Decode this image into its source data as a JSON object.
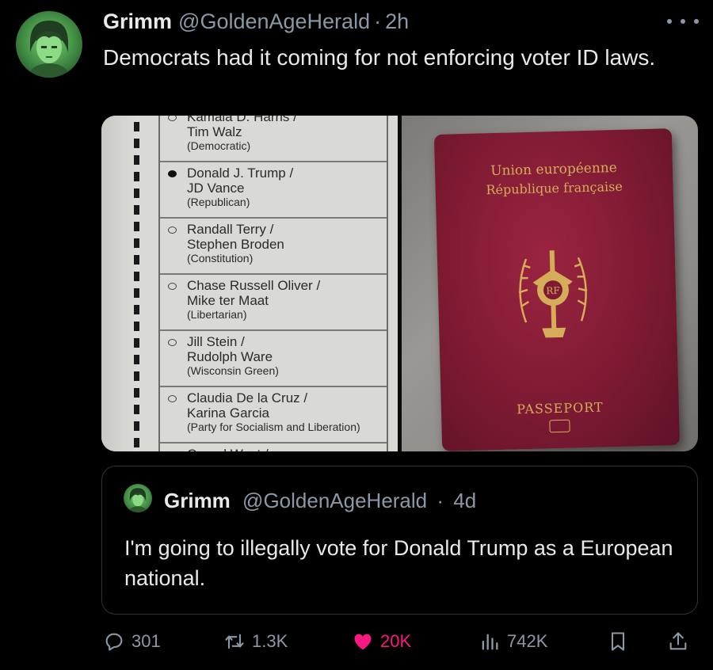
{
  "post": {
    "author_name": "Grimm",
    "author_handle": "@GoldenAgeHerald",
    "separator": "·",
    "time": "2h",
    "text": "Democrats had it coming for not enforcing voter ID laws."
  },
  "ballot": {
    "candidates": [
      {
        "line1": "Kamala D. Harris /",
        "line2": "Tim Walz",
        "party": "(Democratic)",
        "filled": false
      },
      {
        "line1": "Donald J. Trump /",
        "line2": "JD Vance",
        "party": "(Republican)",
        "filled": true
      },
      {
        "line1": "Randall Terry /",
        "line2": "Stephen Broden",
        "party": "(Constitution)",
        "filled": false
      },
      {
        "line1": "Chase Russell Oliver /",
        "line2": "Mike ter Maat",
        "party": "(Libertarian)",
        "filled": false
      },
      {
        "line1": "Jill Stein /",
        "line2": "Rudolph Ware",
        "party": "(Wisconsin Green)",
        "filled": false
      },
      {
        "line1": "Claudia De la Cruz /",
        "line2": "Karina Garcia",
        "party": "(Party for Socialism and Liberation)",
        "filled": false
      },
      {
        "line1": "Cornel West /",
        "line2": "",
        "party": "",
        "filled": false
      }
    ]
  },
  "passport": {
    "union": "Union européenne",
    "republic": "République française",
    "label": "PASSEPORT"
  },
  "quoted": {
    "author_name": "Grimm",
    "author_handle": "@GoldenAgeHerald",
    "separator": "·",
    "time": "4d",
    "text": "I'm going to illegally vote for Donald Trump as a European national."
  },
  "actions": {
    "replies": "301",
    "reposts": "1.3K",
    "likes": "20K",
    "views": "742K"
  },
  "colors": {
    "background": "#000000",
    "text": "#e7e9ea",
    "muted": "#8b98a5",
    "like": "#f91880",
    "border": "#2f3336"
  }
}
